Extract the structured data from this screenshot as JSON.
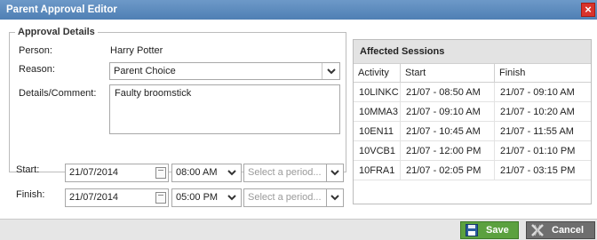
{
  "window": {
    "title": "Parent Approval Editor",
    "close_glyph": "×"
  },
  "approval": {
    "legend": "Approval Details",
    "person_label": "Person:",
    "person_value": "Harry Potter",
    "reason_label": "Reason:",
    "reason_value": "Parent Choice",
    "details_label": "Details/Comment:",
    "details_value": "Faulty broomstick"
  },
  "start": {
    "label": "Start:",
    "date": "21/07/2014",
    "time": "08:00 AM",
    "period_placeholder": "Select a period..."
  },
  "finish": {
    "label": "Finish:",
    "date": "21/07/2014",
    "time": "05:00 PM",
    "period_placeholder": "Select a period..."
  },
  "sessions": {
    "title": "Affected Sessions",
    "columns": [
      "Activity",
      "Start",
      "Finish"
    ],
    "rows": [
      [
        "10LINKC",
        "21/07 - 08:50 AM",
        "21/07 - 09:10 AM"
      ],
      [
        "10MMA3",
        "21/07 - 09:10 AM",
        "21/07 - 10:20 AM"
      ],
      [
        "10EN11",
        "21/07 - 10:45 AM",
        "21/07 - 11:55 AM"
      ],
      [
        "10VCB1",
        "21/07 - 12:00 PM",
        "21/07 - 01:10 PM"
      ],
      [
        "10FRA1",
        "21/07 - 02:05 PM",
        "21/07 - 03:15 PM"
      ]
    ]
  },
  "footer": {
    "save_label": "Save",
    "cancel_label": "Cancel"
  },
  "colors": {
    "titlebar": "#5a89bd",
    "save": "#5ba13f",
    "cancel": "#6e6e6e",
    "close": "#d9332b"
  },
  "icons": {
    "save": "floppy-disk-icon",
    "cancel": "cancel-x-icon",
    "calendar": "calendar-icon",
    "dropdown": "chevron-down-icon"
  }
}
